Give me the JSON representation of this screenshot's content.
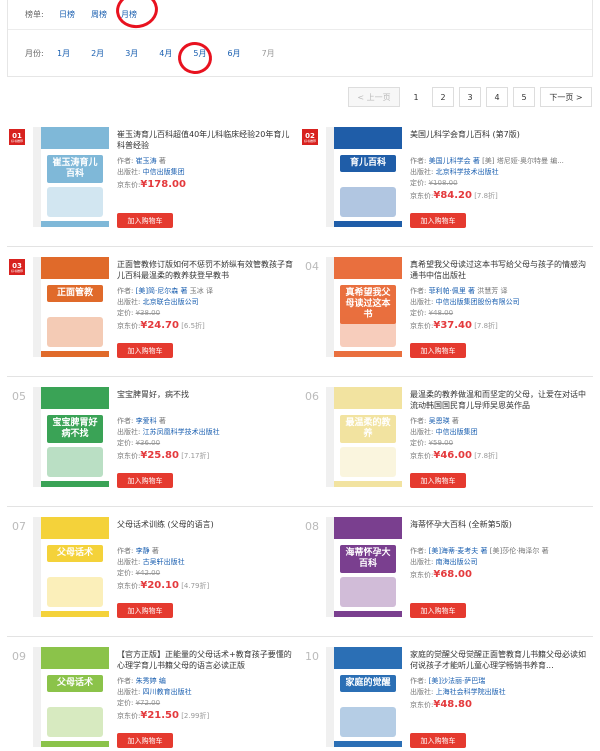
{
  "filter": {
    "chart_label": "榜单:",
    "chart_options": [
      "日榜",
      "周榜",
      "月榜"
    ],
    "month_label": "月份:",
    "months": [
      "1月",
      "2月",
      "3月",
      "4月",
      "5月",
      "6月",
      "7月"
    ]
  },
  "pager": {
    "prev": "< 上一页",
    "pages": [
      "1",
      "2",
      "3",
      "4",
      "5"
    ],
    "current": "1",
    "next": "下一页 >"
  },
  "labels": {
    "author": "作者:",
    "publisher": "出版社:",
    "list_price": "定价:",
    "jd_price": "京东价:",
    "add_to_cart": "加入购物车",
    "rank_tag": "好书推荐"
  },
  "books": [
    {
      "rank": "01",
      "title": "崔玉涛育儿百科超值40年儿科临床经验20年育儿科普经验",
      "author": "崔玉涛",
      "author_suffix": "著",
      "translator": "",
      "publisher": "中信出版集团",
      "list_price": "",
      "price": "¥178.00",
      "discount": "",
      "cover_text": "崔玉涛育儿百科",
      "cover_color": "#7fb8d8"
    },
    {
      "rank": "02",
      "title": "美国儿科学会育儿百科 (第7版)",
      "author": "美国儿科学会 著",
      "author_suffix": "[美] 塔尼娅·奥尔特曼 编...",
      "translator": "",
      "publisher": "北京科学技术出版社",
      "list_price": "¥108.00",
      "price": "¥84.20",
      "discount": "[7.8折]",
      "cover_text": "育儿百科",
      "cover_color": "#1f5da8"
    },
    {
      "rank": "03",
      "title": "正面管教修订版如何不惩罚不娇纵有效管教孩子育儿百科最温柔的教养获登早教书",
      "author": "[美]简·尼尔森 著",
      "author_suffix": "玉冰 译",
      "translator": "",
      "publisher": "北京联合出版公司",
      "list_price": "¥38.00",
      "price": "¥24.70",
      "discount": "[6.5折]",
      "cover_text": "正面管教",
      "cover_color": "#e06a2a"
    },
    {
      "rank": "04",
      "title": "真希望我父母读过这本书写给父母与孩子的情感沟通书中信出版社",
      "author": "菲利帕·佩里 著",
      "author_suffix": "洪慧芳 译",
      "translator": "",
      "publisher": "中信出版集团股份有限公司",
      "list_price": "¥48.00",
      "price": "¥37.40",
      "discount": "[7.8折]",
      "cover_text": "真希望我父母读过这本书",
      "cover_color": "#e96f3e"
    },
    {
      "rank": "05",
      "title": "宝宝脾胃好，病不找",
      "author": "李爱科",
      "author_suffix": "著",
      "translator": "",
      "publisher": "江苏凤凰科学技术出版社",
      "list_price": "¥36.00",
      "price": "¥25.80",
      "discount": "[7.17折]",
      "cover_text": "宝宝脾胃好病不找",
      "cover_color": "#3aa356"
    },
    {
      "rank": "06",
      "title": "最温柔的教养做温和而坚定的父母，让爱在对话中流动韩国国民育儿导师吴恩英作品",
      "author": "吴恩瑛",
      "author_suffix": "著",
      "translator": "",
      "publisher": "中信出版集团",
      "list_price": "¥59.00",
      "price": "¥46.00",
      "discount": "[7.8折]",
      "cover_text": "最温柔的教养",
      "cover_color": "#f2e3a0"
    },
    {
      "rank": "07",
      "title": "父母话术训练 (父母的语言)",
      "author": "李静",
      "author_suffix": "著",
      "translator": "",
      "publisher": "古吴轩出版社",
      "list_price": "¥42.00",
      "price": "¥20.10",
      "discount": "[4.79折]",
      "cover_text": "父母话术",
      "cover_color": "#f4d23a"
    },
    {
      "rank": "08",
      "title": "海蒂怀孕大百科 (全新第5版)",
      "author": "[美]海蒂·麦考夫 著",
      "author_suffix": "[美]莎伦·梅泽尔 著",
      "translator": "",
      "publisher": "南海出版公司",
      "list_price": "",
      "price": "¥68.00",
      "discount": "",
      "cover_text": "海蒂怀孕大百科",
      "cover_color": "#7a3f8f"
    },
    {
      "rank": "09",
      "title": "【官方正版】正能量的父母话术+教育孩子要懂的心理学育儿书籍父母的语言必读正版",
      "author": "朱秀婷 编",
      "author_suffix": "",
      "translator": "",
      "publisher": "四川教育出版社",
      "list_price": "¥72.00",
      "price": "¥21.50",
      "discount": "[2.99折]",
      "cover_text": "父母话术",
      "cover_color": "#8bc34a"
    },
    {
      "rank": "10",
      "title": "家庭的觉醒父母觉醒正面管教育儿书籍父母必读如何说孩子才能听儿童心理学畅销书养育...",
      "author": "[美]沙法丽·萨巴瑞",
      "author_suffix": "",
      "translator": "",
      "publisher": "上海社会科学院出版社",
      "list_price": "",
      "price": "¥48.80",
      "discount": "",
      "cover_text": "家庭的觉醒",
      "cover_color": "#2b6fb5"
    }
  ]
}
